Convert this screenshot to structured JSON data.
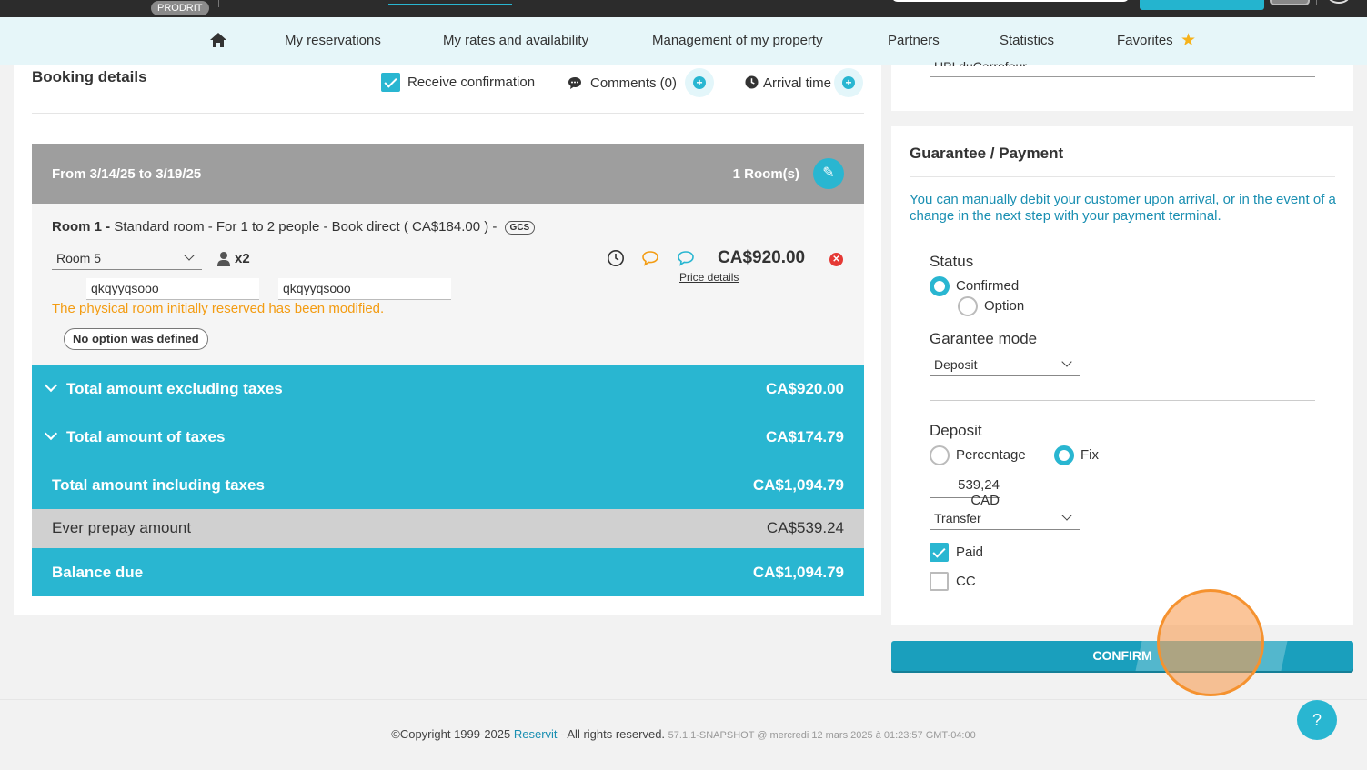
{
  "topbar": {
    "badge": "PRODRIT"
  },
  "nav": {
    "items": [
      "My reservations",
      "My rates and availability",
      "Management of my property",
      "Partners",
      "Statistics",
      "Favorites"
    ]
  },
  "booking": {
    "title": "Booking details",
    "receive_confirmation": "Receive confirmation",
    "comments": "Comments (0)",
    "arrival_time": "Arrival time",
    "dates": "From 3/14/25 to 3/19/25",
    "rooms_count": "1 Room(s)",
    "room_label": "Room 1 -",
    "room_desc": " Standard room - For 1 to 2 people - Book direct ( CA$184.00 ) - ",
    "room_tag": "GCS",
    "room_select": "Room 5",
    "guests": "x2",
    "guest_first": "qkqyyqsooo",
    "guest_last": "qkqyyqsooo",
    "warning": "The physical room initially reserved has been modified.",
    "no_option": "No option was defined",
    "price": "CA$920.00",
    "price_details": "Price details"
  },
  "totals": {
    "excl_label": "Total amount excluding taxes",
    "excl_value": "CA$920.00",
    "taxes_label": "Total amount of taxes",
    "taxes_value": "CA$174.79",
    "incl_label": "Total amount including taxes",
    "incl_value": "CA$1,094.79",
    "prepay_label": "Ever prepay amount",
    "prepay_value": "CA$539.24",
    "balance_label": "Balance due",
    "balance_value": "CA$1,094.79"
  },
  "right": {
    "partial_text": "UPI duCarrefour",
    "gp_title": "Guarantee / Payment",
    "gp_info": "You can manually debit your customer upon arrival, or in the event of a change in the next step with your payment terminal.",
    "status_label": "Status",
    "status_confirmed": "Confirmed",
    "status_option": "Option",
    "garantee_label": "Garantee mode",
    "garantee_value": "Deposit",
    "deposit_label": "Deposit",
    "deposit_percentage": "Percentage",
    "deposit_fix": "Fix",
    "deposit_amount": "539,24 CAD",
    "method_value": "Transfer",
    "paid_label": "Paid",
    "cc_label": "CC",
    "confirm_label": "CONFIRM"
  },
  "footer": {
    "copyright": "©Copyright 1999-2025 ",
    "brand": "Reservit",
    "rights": " - All rights reserved. ",
    "version": "57.1.1-SNAPSHOT @ mercredi 12 mars 2025 à 01:23:57 GMT-04:00",
    "help": "?"
  },
  "colors": {
    "accent": "#29b6d1",
    "warning": "#f39c12",
    "info": "#1a8fb2"
  }
}
